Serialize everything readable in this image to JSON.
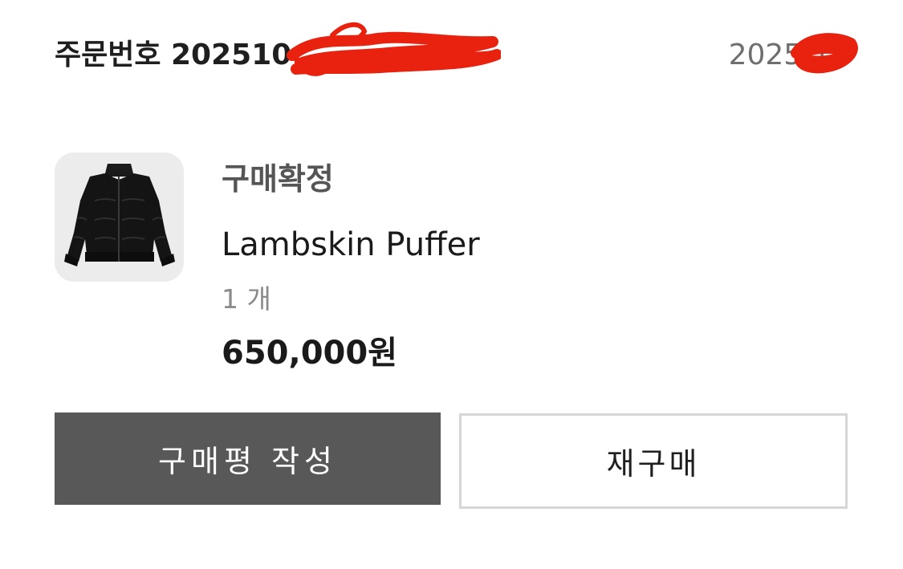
{
  "order": {
    "number_label": "주문번호 202510",
    "date": "2025-10"
  },
  "product": {
    "status": "구매확정",
    "name": "Lambskin Puffer",
    "quantity": "1 개",
    "price": "650,000원",
    "image_icon": "black-puffer-jacket"
  },
  "actions": {
    "review_label": "구매평 작성",
    "rebuy_label": "재구매"
  },
  "colors": {
    "review_button": "#585858",
    "redaction": "#e8220f"
  }
}
